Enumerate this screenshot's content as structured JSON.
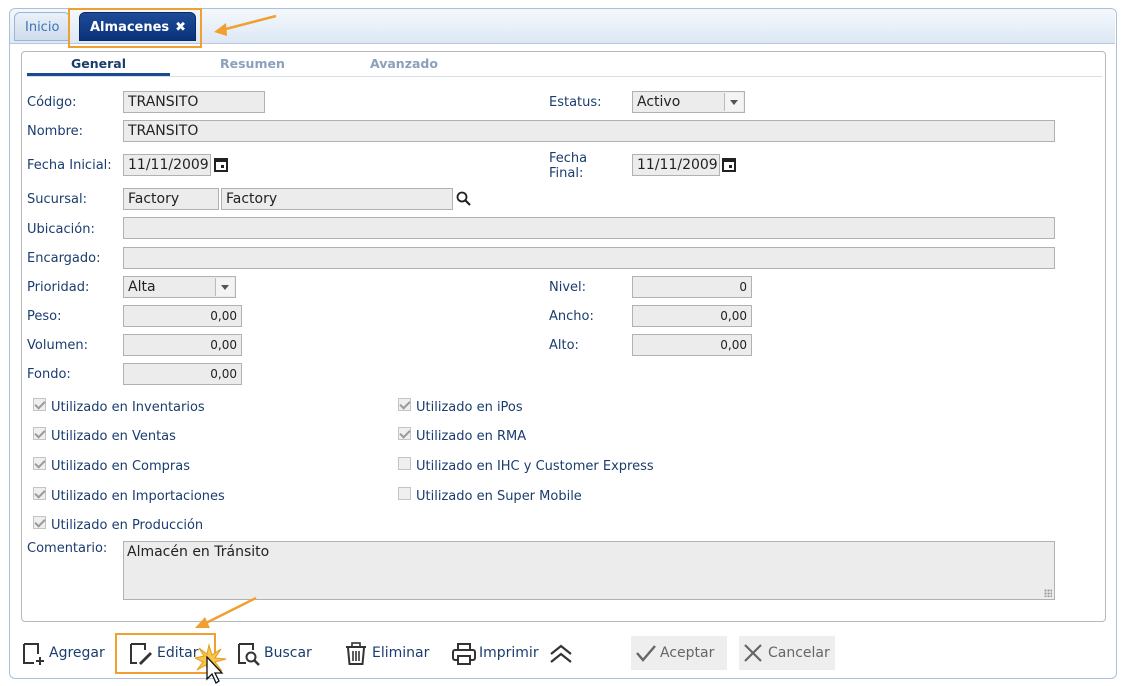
{
  "tabs": [
    {
      "label": "Inicio"
    },
    {
      "label": "Almacenes",
      "close": "✖"
    }
  ],
  "subtabs": [
    "General",
    "Resumen",
    "Avanzado"
  ],
  "form": {
    "codigo": {
      "label": "Código:",
      "value": "TRANSITO"
    },
    "estatus": {
      "label": "Estatus:",
      "value": "Activo"
    },
    "nombre": {
      "label": "Nombre:",
      "value": "TRANSITO"
    },
    "fecha_inicial": {
      "label": "Fecha Inicial:",
      "value": "11/11/2009"
    },
    "fecha_final": {
      "label_line1": "Fecha",
      "label_line2": "Final:",
      "value": "11/11/2009"
    },
    "sucursal": {
      "label": "Sucursal:",
      "code": "Factory",
      "name": "Factory"
    },
    "ubicacion": {
      "label": "Ubicación:",
      "value": ""
    },
    "encargado": {
      "label": "Encargado:",
      "value": ""
    },
    "prioridad": {
      "label": "Prioridad:",
      "value": "Alta"
    },
    "nivel": {
      "label": "Nivel:",
      "value": "0"
    },
    "peso": {
      "label": "Peso:",
      "value": "0,00"
    },
    "ancho": {
      "label": "Ancho:",
      "value": "0,00"
    },
    "volumen": {
      "label": "Volumen:",
      "value": "0,00"
    },
    "alto": {
      "label": "Alto:",
      "value": "0,00"
    },
    "fondo": {
      "label": "Fondo:",
      "value": "0,00"
    },
    "comentario": {
      "label": "Comentario:",
      "value": "Almacén en Tránsito"
    }
  },
  "checkboxes_left": [
    {
      "label": "Utilizado en Inventarios",
      "checked": true
    },
    {
      "label": "Utilizado en Ventas",
      "checked": true
    },
    {
      "label": "Utilizado en Compras",
      "checked": true
    },
    {
      "label": "Utilizado en Importaciones",
      "checked": true
    },
    {
      "label": "Utilizado en Producción",
      "checked": true
    }
  ],
  "checkboxes_right": [
    {
      "label": "Utilizado en iPos",
      "checked": true
    },
    {
      "label": "Utilizado en RMA",
      "checked": true
    },
    {
      "label": "Utilizado en IHC y Customer Express",
      "checked": false
    },
    {
      "label": "Utilizado en Super Mobile",
      "checked": false
    }
  ],
  "toolbar": {
    "agregar": "Agregar",
    "editar": "Editar",
    "buscar": "Buscar",
    "eliminar": "Eliminar",
    "imprimir": "Imprimir",
    "aceptar": "Aceptar",
    "cancelar": "Cancelar"
  },
  "colors": {
    "highlight": "#f0a030",
    "active_tab": "#0a327b",
    "label": "#1a3d6e"
  }
}
